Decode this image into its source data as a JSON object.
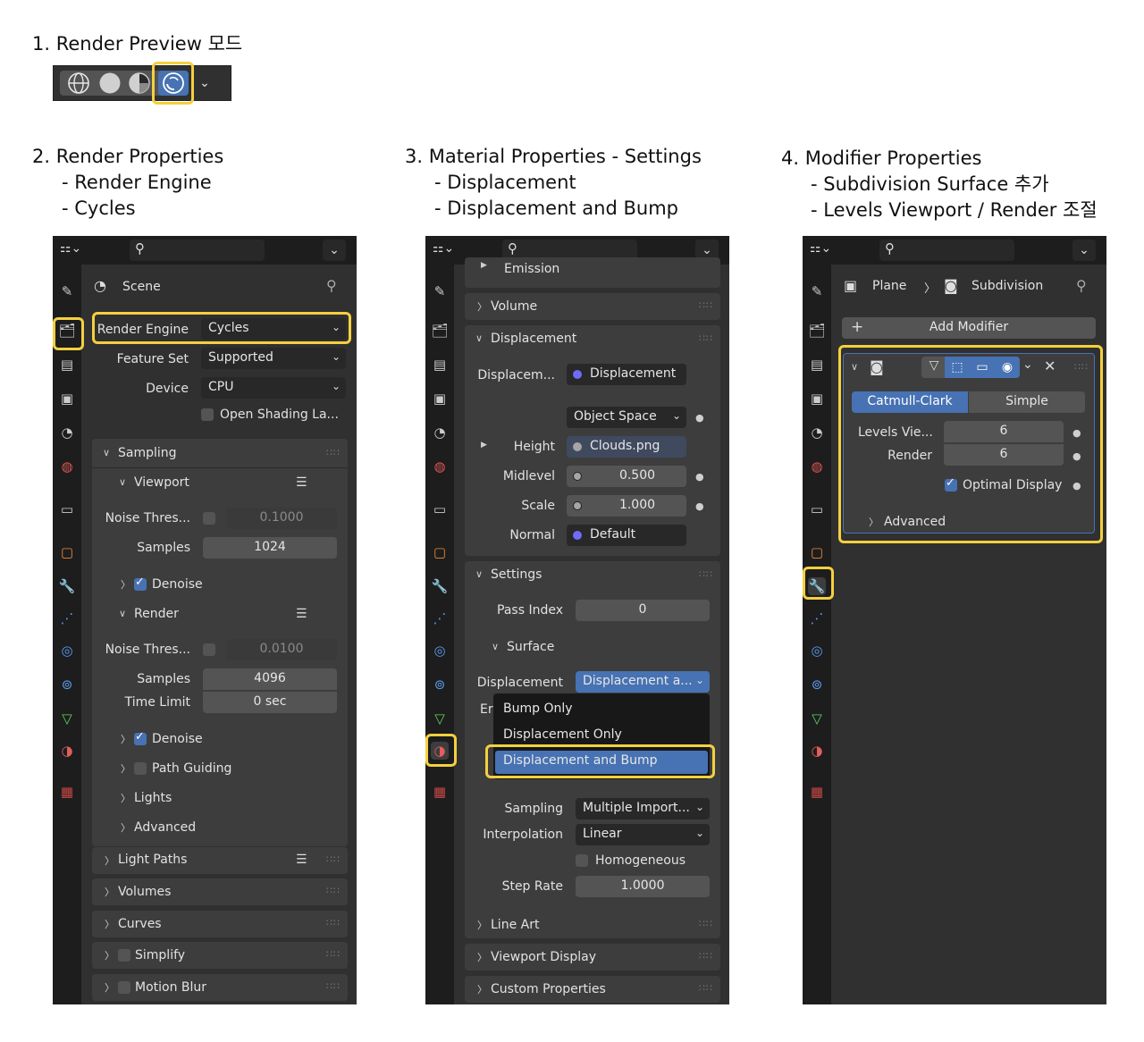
{
  "captions": {
    "c1": "1. Render Preview 모드",
    "c2": [
      "2. Render Properties",
      "- Render Engine",
      "- Cycles"
    ],
    "c3": [
      "3. Material Properties - Settings",
      "- Displacement",
      "- Displacement and Bump"
    ],
    "c4": [
      "4. Modifier Properties",
      "- Subdivision Surface 추가",
      "- Levels Viewport / Render 조절"
    ]
  },
  "shading_toolbar": {
    "icons": [
      "wireframe-icon",
      "solid-icon",
      "material-preview-icon",
      "rendered-icon",
      "chevron-down-icon"
    ]
  },
  "panel_render": {
    "header_title": "Scene",
    "engine_label": "Render Engine",
    "engine_value": "Cycles",
    "feature_label": "Feature Set",
    "feature_value": "Supported",
    "device_label": "Device",
    "device_value": "CPU",
    "osl_label": "Open Shading La...",
    "sampling": "Sampling",
    "viewport": "Viewport",
    "noise_label": "Noise Thres...",
    "vp_noise": "0.1000",
    "samples_label": "Samples",
    "vp_samples": "1024",
    "denoise": "Denoise",
    "render": "Render",
    "r_noise": "0.0100",
    "r_samples": "4096",
    "time_limit_label": "Time Limit",
    "time_limit": "0 sec",
    "path_guiding": "Path Guiding",
    "lights": "Lights",
    "advanced": "Advanced",
    "light_paths": "Light Paths",
    "volumes": "Volumes",
    "curves": "Curves",
    "simplify": "Simplify",
    "motion_blur": "Motion Blur"
  },
  "panel_material": {
    "emission": "Emission",
    "volume": "Volume",
    "displacement": "Displacement",
    "displacem_label": "Displacem...",
    "displacement_node": "Displacement",
    "object_space": "Object Space",
    "height_label": "Height",
    "height_value": "Clouds.png",
    "midlevel_label": "Midlevel",
    "midlevel_value": "0.500",
    "scale_label": "Scale",
    "scale_value": "1.000",
    "normal_label": "Normal",
    "normal_value": "Default",
    "settings": "Settings",
    "pass_index_label": "Pass Index",
    "pass_index_value": "0",
    "surface": "Surface",
    "disp_method_label": "Displacement",
    "disp_method_value": "Displacement a...",
    "menu_partial_label": "Er",
    "menu": [
      "Bump Only",
      "Displacement Only",
      "Displacement and Bump"
    ],
    "sampling_label": "Sampling",
    "sampling_value": "Multiple Import...",
    "interp_label": "Interpolation",
    "interp_value": "Linear",
    "homogeneous": "Homogeneous",
    "step_label": "Step Rate",
    "step_value": "1.0000",
    "line_art": "Line Art",
    "viewport_display": "Viewport Display",
    "custom_props": "Custom Properties"
  },
  "panel_modifier": {
    "object": "Plane",
    "modifier": "Subdivision",
    "add_modifier": "Add Modifier",
    "catmull": "Catmull-Clark",
    "simple": "Simple",
    "levels_label": "Levels Vie...",
    "levels_value": "6",
    "render_label": "Render",
    "render_value": "6",
    "optimal": "Optimal Display",
    "advanced": "Advanced"
  },
  "colors": {
    "highlight": "#f4d03f",
    "accent": "#4772b3",
    "panel_bg": "#303030",
    "sidebar_bg": "#1d1d1d"
  }
}
